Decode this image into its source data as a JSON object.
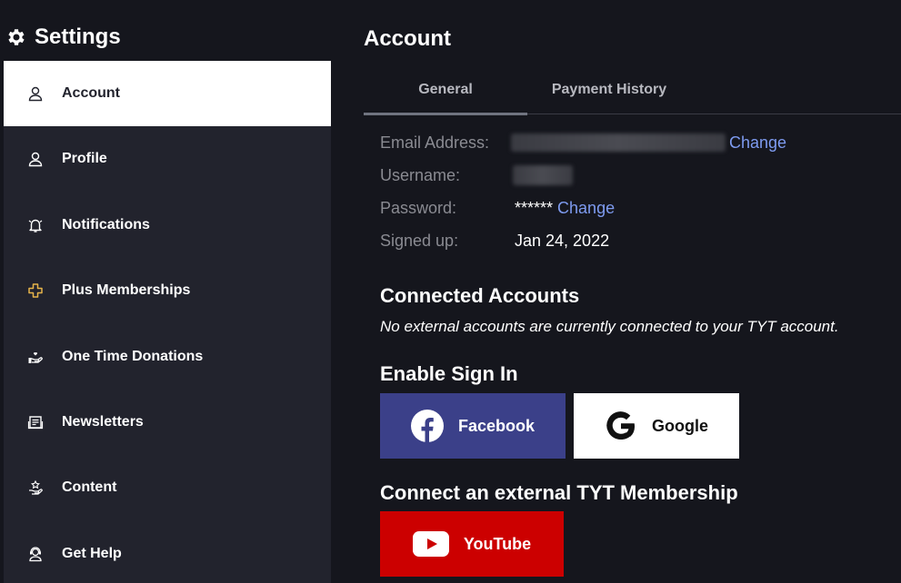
{
  "sidebar": {
    "title": "Settings",
    "items": [
      {
        "label": "Account"
      },
      {
        "label": "Profile"
      },
      {
        "label": "Notifications"
      },
      {
        "label": "Plus Memberships"
      },
      {
        "label": "One Time Donations"
      },
      {
        "label": "Newsletters"
      },
      {
        "label": "Content"
      },
      {
        "label": "Get Help"
      }
    ]
  },
  "main": {
    "title": "Account",
    "tabs": [
      {
        "label": "General"
      },
      {
        "label": "Payment History"
      }
    ],
    "account_info": {
      "email_label": "Email Address:",
      "email_change": "Change",
      "username_label": "Username:",
      "password_label": "Password:",
      "password_value": "******",
      "password_change": "Change",
      "signed_up_label": "Signed up:",
      "signed_up_value": "Jan 24, 2022"
    },
    "connected": {
      "heading": "Connected Accounts",
      "note": "No external accounts are currently connected to your TYT account."
    },
    "sign_in": {
      "heading": "Enable Sign In",
      "facebook_label": "Facebook",
      "google_label": "Google"
    },
    "external": {
      "heading": "Connect an external TYT Membership",
      "youtube_label": "YouTube"
    }
  },
  "colors": {
    "background": "#15161d",
    "sidebar": "#22232d",
    "link": "#7e9bf0",
    "facebook": "#3b4089",
    "youtube": "#cc0000",
    "plus_icon": "#e6b34a"
  }
}
